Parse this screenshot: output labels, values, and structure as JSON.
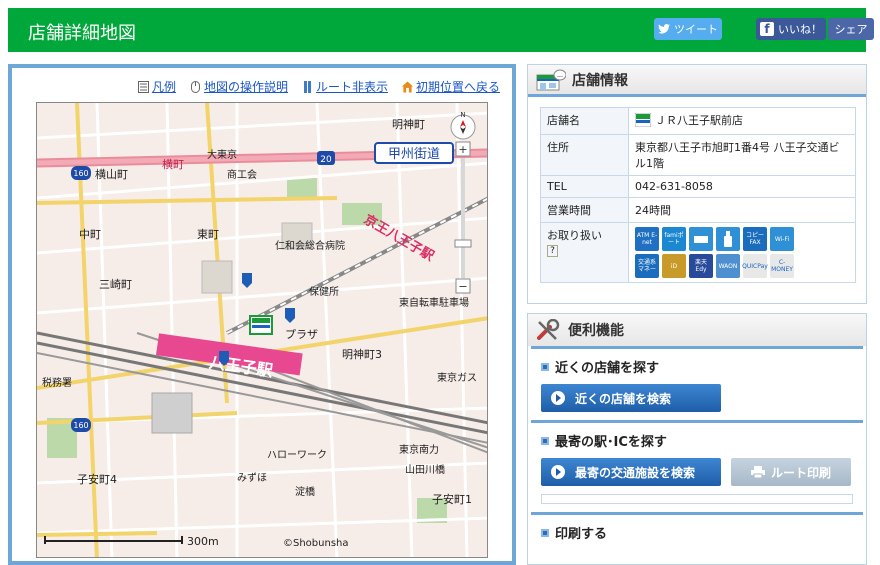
{
  "header": {
    "title": "店舗詳細地図",
    "tweet_label": "ツイート",
    "like_label": "いいね！",
    "share_label": "シェア"
  },
  "map_links": {
    "legend": "凡例",
    "operation": "地図の操作説明",
    "route_hide": "ルート非表示",
    "reset_position": "初期位置へ戻る"
  },
  "map": {
    "scale": "300m",
    "copyright": "©Shobunsha",
    "labels": {
      "koshu_kaido": "甲州街道",
      "hachioji_eki": "八王子駅",
      "keio_hachioji": "京王八王子駅",
      "yokoyamacho": "横山町",
      "yokocho": "横町",
      "nakamachi": "中町",
      "higashimachi": "東町",
      "sankomachi": "三崎町",
      "mizuho": "みずほ",
      "shinmeicho": "明神町",
      "shinmeicho3": "明神町3",
      "koyasu4": "子安町4",
      "koyasu1": "子安町1",
      "azumacho": "東町",
      "plaza": "プラザ",
      "route20": "20",
      "route160a": "160",
      "route160b": "160",
      "daitomaru": "大東京",
      "jinushi": "東京ガス",
      "zeimusho": "税務署",
      "hospital": "仁和会総合病院",
      "shoko": "商工会",
      "hoken": "保健所",
      "jiten": "東自転車駐車場",
      "tokyomichi": "東京南力",
      "sanbasi": "山田川橋",
      "yodo": "淀橋",
      "roomu": "ハローワーク"
    }
  },
  "info": {
    "title": "店舗情報",
    "rows": [
      {
        "key": "店舗名",
        "value": "ＪＲ八王子駅前店"
      },
      {
        "key": "住所",
        "value": "東京都八王子市旭町1番4号 八王子交通ビル1階"
      },
      {
        "key": "TEL",
        "value": "042-631-8058"
      },
      {
        "key": "営業時間",
        "value": "24時間"
      },
      {
        "key": "お取り扱い",
        "value": ""
      }
    ],
    "services": [
      {
        "label": "ATM E-net",
        "color": "#1f6fc2"
      },
      {
        "label": "famiポート",
        "color": "#1a87d0"
      },
      {
        "label": "",
        "color": "#2f90d6"
      },
      {
        "label": "",
        "color": "#2f90d6"
      },
      {
        "label": "コピー FAX",
        "color": "#1a6cbd"
      },
      {
        "label": "Wi-Fi",
        "color": "#2f90d6"
      },
      {
        "label": "交通系 マネー",
        "color": "#1a6cbd"
      },
      {
        "label": "iD",
        "color": "#c79a2a"
      },
      {
        "label": "楽天 Edy",
        "color": "#274a9a"
      },
      {
        "label": "WAON",
        "color": "#4e8fd0"
      },
      {
        "label": "QUICPay",
        "color": "#e8e8e8"
      },
      {
        "label": "C-MONEY",
        "color": "#e8e8e8"
      }
    ]
  },
  "tools": {
    "title": "便利機能",
    "nearby_title": "近くの店舗を探す",
    "nearby_btn": "近くの店舗を検索",
    "station_title": "最寄の駅･ICを探す",
    "station_btn": "最寄の交通施設を検索",
    "route_print": "ルート印刷",
    "print_title": "印刷する"
  }
}
